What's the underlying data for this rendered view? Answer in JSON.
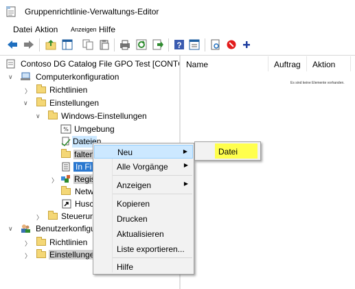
{
  "window": {
    "title": "Gruppenrichtlinie-Verwaltungs-Editor"
  },
  "menubar": {
    "items": [
      "Datei",
      "Aktion",
      "Anzeigen",
      "Hilfe"
    ]
  },
  "toolbar": {
    "buttons": [
      "back-arrow-icon",
      "forward-arrow-icon",
      "up-folder-icon",
      "show-tree-icon",
      "copy-icon",
      "paste-icon",
      "print-icon",
      "refresh-icon",
      "export-list-icon",
      "help-icon",
      "properties-icon",
      "new-item-icon",
      "delete-icon",
      "add-icon"
    ]
  },
  "tree": {
    "root": "Contoso DG Catalog File GPO Test [CONTC",
    "computer_config": "Computerkonfiguration",
    "richtlinien_1": "Richtlinien",
    "einstellungen_1": "Einstellungen",
    "windows_einstellungen": "Windows-Einstellungen",
    "umgebung": "Umgebung",
    "dateien": "Dateien",
    "ordner_partial": "falten",
    "ini_partial": "In Fi",
    "registry_partial": "Regis",
    "netzwerk_partial": "Netw",
    "verknuepfungen_partial": "Husch",
    "steuerung": "Steuerung",
    "user_config": "Benutzerkonfiguration",
    "richtlinien_2": "Richtlinien",
    "einstellungen_2": "Einstellungen"
  },
  "list": {
    "columns": [
      "Name",
      "Auftrag",
      "Aktion"
    ],
    "empty_text": "Es sind keine Elemente vorhanden."
  },
  "context_menu": {
    "items": [
      "Neu",
      "Alle Vorgänge",
      "Anzeigen",
      "Kopieren",
      "Drucken",
      "Aktualisieren",
      "Liste exportieren...",
      "Hilfe"
    ]
  },
  "submenu": {
    "items": [
      "Datei"
    ]
  },
  "colors": {
    "highlight_yellow": "#ffff4d",
    "menu_bg": "#f2f2f2",
    "hover_blue": "#cce8ff"
  }
}
